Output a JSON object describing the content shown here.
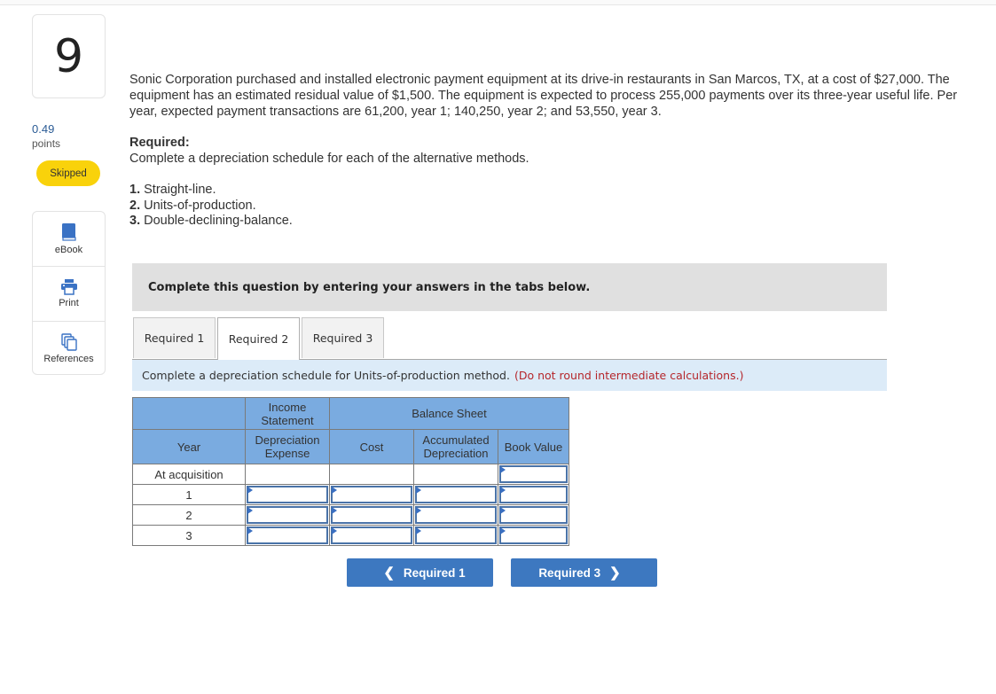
{
  "question": {
    "number": "9",
    "points_value": "0.49",
    "points_label": "points",
    "status_badge": "Skipped",
    "text": "Sonic Corporation purchased and installed electronic payment equipment at its drive-in restaurants in San Marcos, TX, at a cost of $27,000. The equipment has an estimated residual value of $1,500. The equipment is expected to process 255,000 payments over its three-year useful life. Per year, expected payment transactions are 61,200, year 1; 140,250, year 2; and 53,550, year 3.",
    "required_heading": "Required:",
    "required_body": "Complete a depreciation schedule for each of the alternative methods.",
    "methods": [
      {
        "num": "1.",
        "label": "Straight-line."
      },
      {
        "num": "2.",
        "label": "Units-of-production."
      },
      {
        "num": "3.",
        "label": "Double-declining-balance."
      }
    ]
  },
  "tools": [
    {
      "icon": "book-icon",
      "label": "eBook"
    },
    {
      "icon": "printer-icon",
      "label": "Print"
    },
    {
      "icon": "copy-icon",
      "label": "References"
    }
  ],
  "banner": "Complete this question by entering your answers in the tabs below.",
  "tabs": [
    {
      "label": "Required 1",
      "active": false
    },
    {
      "label": "Required 2",
      "active": true
    },
    {
      "label": "Required 3",
      "active": false
    }
  ],
  "instruction": {
    "text": "Complete a depreciation schedule for Units-of-production method.",
    "note": "(Do not round intermediate calculations.)"
  },
  "table": {
    "group_headers": {
      "income": "Income Statement",
      "balance": "Balance Sheet"
    },
    "columns": [
      "Year",
      "Depreciation Expense",
      "Cost",
      "Accumulated Depreciation",
      "Book Value"
    ],
    "rows": [
      {
        "year": "At acquisition",
        "depreciation": "",
        "cost": "",
        "accumulated": "",
        "book_value": ""
      },
      {
        "year": "1",
        "depreciation": "",
        "cost": "",
        "accumulated": "",
        "book_value": ""
      },
      {
        "year": "2",
        "depreciation": "",
        "cost": "",
        "accumulated": "",
        "book_value": ""
      },
      {
        "year": "3",
        "depreciation": "",
        "cost": "",
        "accumulated": "",
        "book_value": ""
      }
    ]
  },
  "nav": {
    "prev_label": "Required 1",
    "next_label": "Required 3"
  },
  "colors": {
    "accent": "#3d78c0",
    "header_blue": "#7aabe0",
    "badge_yellow": "#f9d20b",
    "note_red": "#b5262b",
    "instruction_bg": "#dcebf8"
  }
}
